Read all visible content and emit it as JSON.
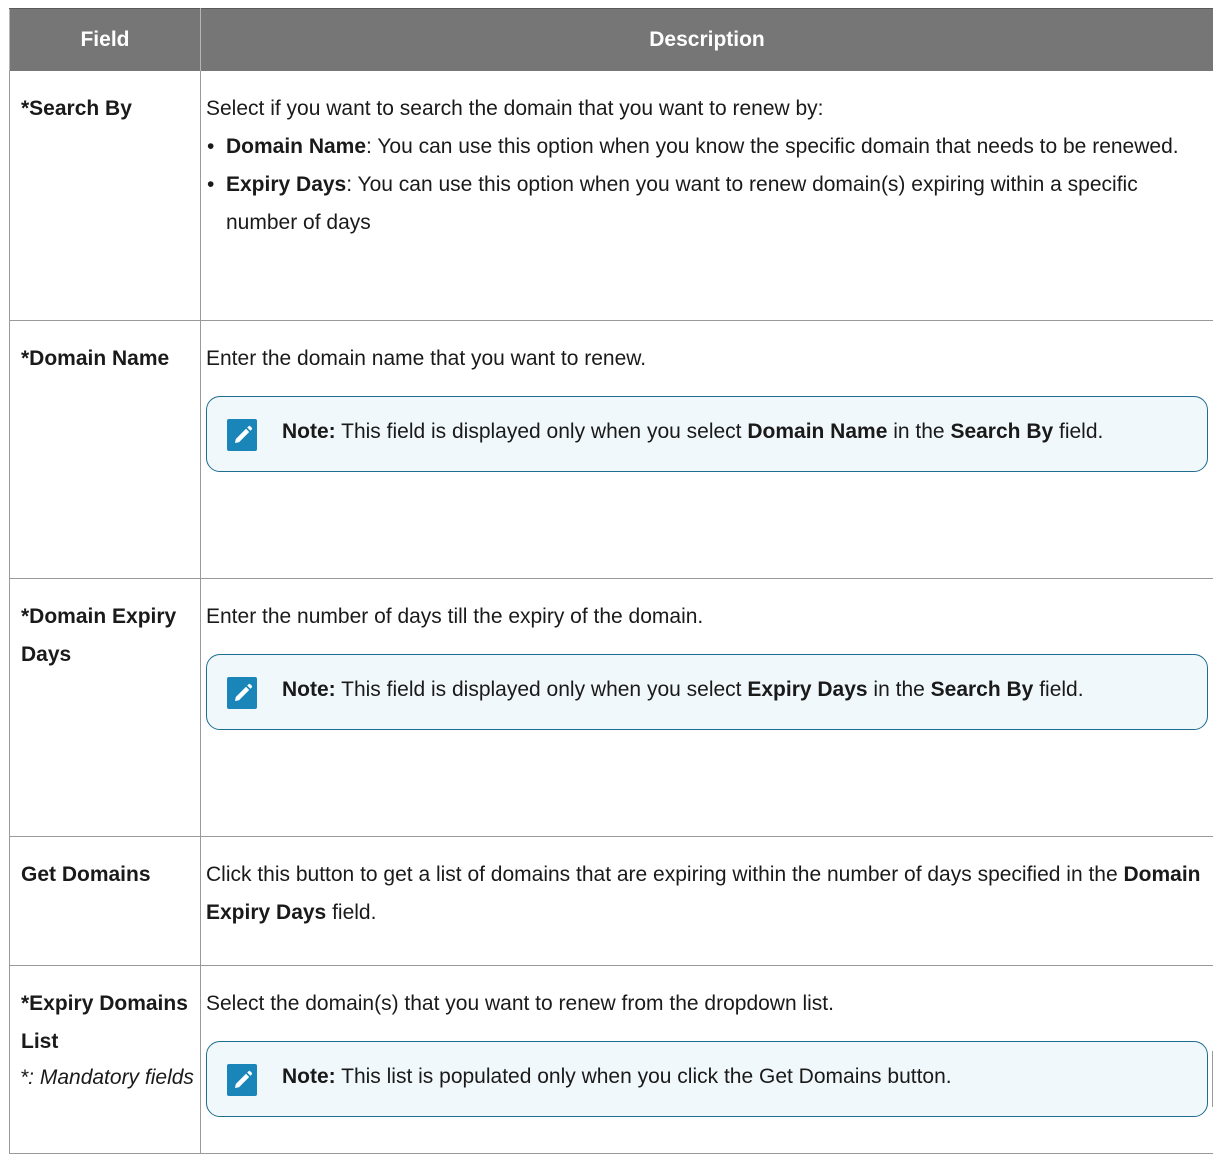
{
  "header": {
    "field": "Field",
    "description": "Description"
  },
  "rows": [
    {
      "field": "*Search By",
      "intro": "Select if you want to search the domain that you want to renew by:",
      "bullets": [
        {
          "term": "Domain Name",
          "text": ": You can use this option when you know the specific domain that needs to be renewed."
        },
        {
          "term": "Expiry Days",
          "text": ": You can use this option when you want to renew domain(s) expiring within a specific number of days"
        }
      ]
    },
    {
      "field": "*Domain Name",
      "intro": "Enter the domain name that you want to renew.",
      "note": {
        "label": "Note:",
        "part1": " This field is displayed only when you select ",
        "bold1": "Domain Name",
        "part2": " in the ",
        "bold2": "Search By",
        "part3": " field."
      }
    },
    {
      "field": "*Domain Expiry Days",
      "intro": "Enter the number of days till the expiry of the domain.",
      "note": {
        "label": "Note:",
        "part1": " This field is displayed only when you select ",
        "bold1": "Expiry Days",
        "part2": " in the ",
        "bold2": "Search By",
        "part3": " field."
      }
    },
    {
      "field": "Get Domains",
      "text1": "Click this button to get a list of domains that are expiring within the number of days specified in the ",
      "bold": "Domain Expiry Days",
      "text2": " field."
    },
    {
      "field": "*Expiry Domains List",
      "intro": "Select the domain(s) that you want to renew from the dropdown list.",
      "note": {
        "label": "Note:",
        "part1": " This list is populated only when you click the Get Domains button."
      }
    }
  ],
  "bullet_char": "•",
  "footer": "*: Mandatory fields",
  "colors": {
    "header_bg": "#767676",
    "note_border": "#1f6d8f",
    "note_icon": "#1a85b8",
    "note_bg": "#f1f8fb"
  },
  "icons": {
    "note": "pencil-note-icon"
  }
}
